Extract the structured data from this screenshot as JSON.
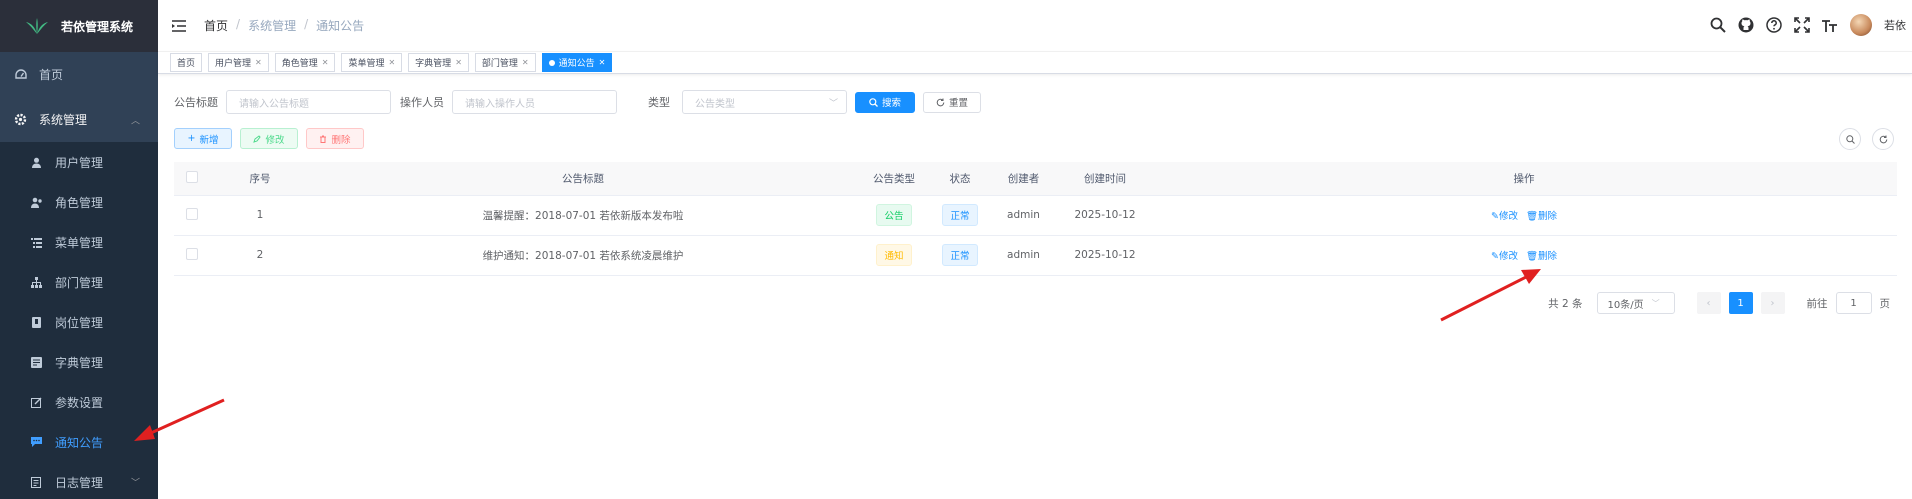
{
  "app": {
    "title": "若依管理系统"
  },
  "sidebar": {
    "items": [
      {
        "label": "首页",
        "icon": "dashboard-icon"
      },
      {
        "label": "系统管理",
        "icon": "gear-icon"
      },
      {
        "label": "用户管理",
        "icon": "user-icon"
      },
      {
        "label": "角色管理",
        "icon": "peoples-icon"
      },
      {
        "label": "菜单管理",
        "icon": "tree-table-icon"
      },
      {
        "label": "部门管理",
        "icon": "tree-icon"
      },
      {
        "label": "岗位管理",
        "icon": "post-icon"
      },
      {
        "label": "字典管理",
        "icon": "dict-icon"
      },
      {
        "label": "参数设置",
        "icon": "edit-icon"
      },
      {
        "label": "通知公告",
        "icon": "message-icon"
      },
      {
        "label": "日志管理",
        "icon": "log-icon"
      }
    ]
  },
  "navbar": {
    "breadcrumb": [
      "首页",
      "系统管理",
      "通知公告"
    ],
    "username": "若依"
  },
  "tags": [
    "首页",
    "用户管理",
    "角色管理",
    "菜单管理",
    "字典管理",
    "部门管理",
    "通知公告"
  ],
  "search": {
    "title_label": "公告标题",
    "title_placeholder": "请输入公告标题",
    "operator_label": "操作人员",
    "operator_placeholder": "请输入操作人员",
    "type_label": "类型",
    "type_placeholder": "公告类型",
    "search_btn": "搜索",
    "reset_btn": "重置"
  },
  "toolbar": {
    "add": "新增",
    "edit": "修改",
    "delete": "删除"
  },
  "table": {
    "headers": [
      "序号",
      "公告标题",
      "公告类型",
      "状态",
      "创建者",
      "创建时间",
      "操作"
    ],
    "rows": [
      {
        "no": "1",
        "title": "温馨提醒：2018-07-01 若依新版本发布啦",
        "type": "公告",
        "status": "正常",
        "creator": "admin",
        "time": "2025-10-12",
        "edit": "修改",
        "delete": "删除"
      },
      {
        "no": "2",
        "title": "维护通知：2018-07-01 若依系统凌晨维护",
        "type": "通知",
        "status": "正常",
        "creator": "admin",
        "time": "2025-10-12",
        "edit": "修改",
        "delete": "删除"
      }
    ]
  },
  "pagination": {
    "total": "共 2 条",
    "page_size": "10条/页",
    "current": "1",
    "goto_label": "前往",
    "goto_value": "1",
    "page_unit": "页"
  },
  "colors": {
    "sidebar_bg": "#304156",
    "primary": "#1890ff",
    "annotation_arrow": "#e02020"
  }
}
